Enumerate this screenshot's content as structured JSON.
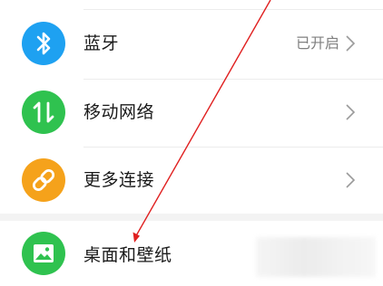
{
  "colors": {
    "bluetooth": "#1ea1f1",
    "mobile_network": "#2fc24f",
    "more_connections": "#f5a21b",
    "desktop_wallpaper": "#2fc24f",
    "annotation_arrow": "#e02020",
    "chevron": "#9a9a9a",
    "value_text": "#808080"
  },
  "settings": {
    "items": [
      {
        "label": "蓝牙",
        "value": "已开启",
        "icon": "bluetooth-icon",
        "has_chevron": true
      },
      {
        "label": "移动网络",
        "value": "",
        "icon": "mobile-data-icon",
        "has_chevron": true
      },
      {
        "label": "更多连接",
        "value": "",
        "icon": "link-icon",
        "has_chevron": true
      },
      {
        "label": "桌面和壁纸",
        "value": "",
        "icon": "image-icon",
        "has_chevron": false
      }
    ]
  }
}
